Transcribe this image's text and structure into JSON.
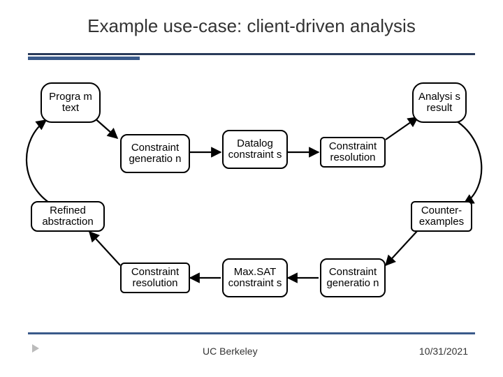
{
  "title": "Example use-case: client-driven analysis",
  "nodes": {
    "program_text": "Progra\nm\ntext",
    "constraint_generation_top": "Constraint\ngeneratio\nn",
    "datalog_constraints": "Datalog\nconstraint\ns",
    "constraint_resolution_top": "Constraint\nresolution",
    "analysis_result": "Analysi\ns\nresult",
    "refined_abstraction": "Refined\nabstraction",
    "counter_examples": "Counter-\nexamples",
    "constraint_resolution_bot": "Constraint\nresolution",
    "maxsat_constraints": "Max.SAT\nconstraint\ns",
    "constraint_generation_bot": "Constraint\ngeneratio\nn"
  },
  "footer": {
    "org": "UC Berkeley",
    "date": "10/31/2021"
  }
}
